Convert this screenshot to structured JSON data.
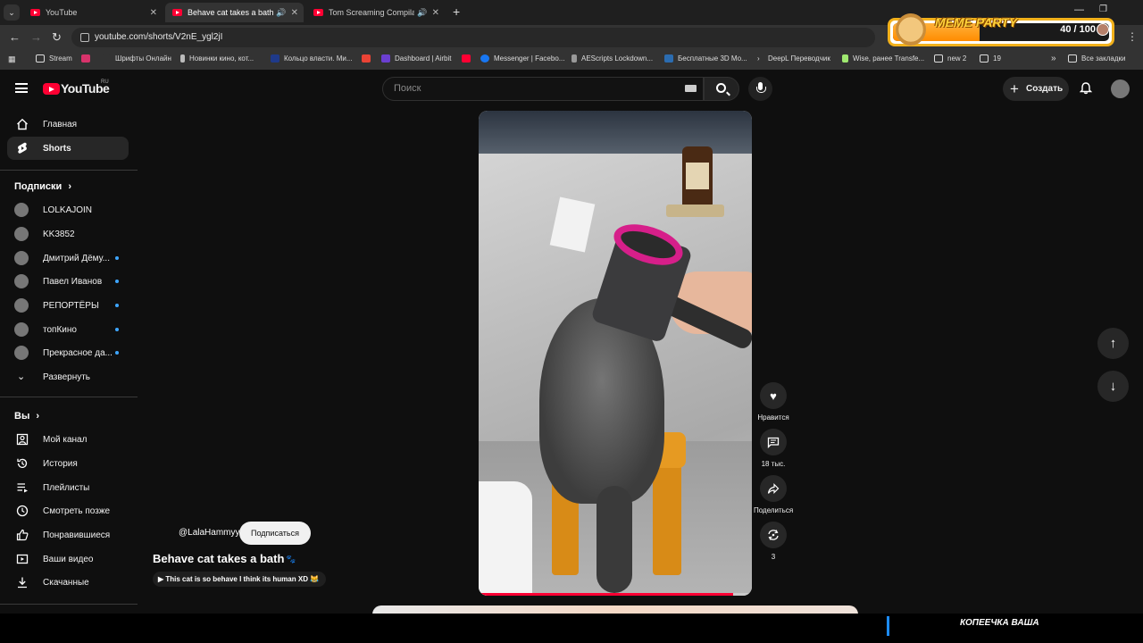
{
  "browser": {
    "tabs": [
      {
        "label": "YouTube",
        "active": false
      },
      {
        "label": "Behave cat takes a bath",
        "active": true
      },
      {
        "label": "Tom Screaming Compilation",
        "active": false
      }
    ],
    "url": "youtube.com/shorts/V2nE_ygl2jI",
    "bookmarks": [
      "Stream",
      "Шрифты Онлайн",
      "Новинки кино, кот...",
      "Кольцо власти. Ми...",
      "Dashboard | Airbit",
      "Messenger | Facebo...",
      "AEScripts Lockdown...",
      "Бесплатные 3D Mo...",
      "DeepL Переводчик",
      "Wise, ранее Transfe...",
      "new 2",
      "19"
    ],
    "all_bookmarks": "Все закладки"
  },
  "meme_party": {
    "title": "MEME PARTY",
    "count": "40 / 100",
    "progress_fraction": 0.4,
    "accent": "#f2b11b"
  },
  "header": {
    "logo": "YouTube",
    "region": "RU",
    "search_placeholder": "Поиск",
    "create_label": "Создать"
  },
  "sidebar": {
    "main": [
      {
        "label": "Главная",
        "icon": "home-icon"
      },
      {
        "label": "Shorts",
        "icon": "shorts-icon",
        "active": true
      }
    ],
    "subs_heading": "Подписки",
    "subs": [
      {
        "label": "LOLKAJOIN",
        "new": false
      },
      {
        "label": "KK3852",
        "new": false
      },
      {
        "label": "Дмитрий Дёму...",
        "new": true
      },
      {
        "label": "Павел Иванов",
        "new": true
      },
      {
        "label": "РЕПОРТЁРЫ",
        "new": true
      },
      {
        "label": "топКино",
        "new": true
      },
      {
        "label": "Прекрасное да...",
        "new": true
      }
    ],
    "expand_label": "Развернуть",
    "you_heading": "Вы",
    "you": [
      {
        "label": "Мой канал",
        "icon": "channel-icon"
      },
      {
        "label": "История",
        "icon": "history-icon"
      },
      {
        "label": "Плейлисты",
        "icon": "playlist-icon"
      },
      {
        "label": "Смотреть позже",
        "icon": "clock-icon"
      },
      {
        "label": "Понравившиеся",
        "icon": "thumbs-up-icon"
      },
      {
        "label": "Ваши видео",
        "icon": "video-icon"
      },
      {
        "label": "Скачанные",
        "icon": "download-icon"
      }
    ]
  },
  "short": {
    "channel": "@LalaHammyy",
    "subscribe_label": "Подписаться",
    "title": "Behave cat takes a bath",
    "description": "▶ This cat is so behave I think its human XD 😹",
    "progress_fraction": 0.93
  },
  "actions": {
    "like_label": "Нравится",
    "comments_count": "18 тыс.",
    "share_label": "Поделиться",
    "remix_count": "3"
  },
  "overlay": {
    "bottom_text": "КОПЕЕЧКА ВАША"
  }
}
